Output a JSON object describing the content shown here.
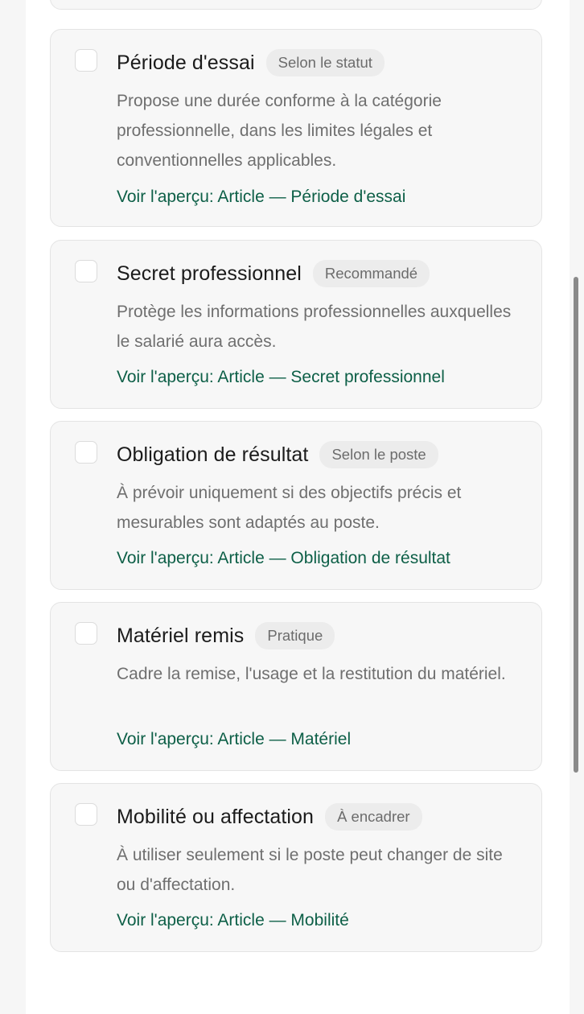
{
  "cards": [
    {
      "title": "Période d'essai",
      "badge": "Selon le statut",
      "description": "Propose une durée conforme à la catégorie professionnelle, dans les limites légales et conventionnelles applicables.",
      "link": "Voir l'aperçu: Article — Période d'essai"
    },
    {
      "title": "Secret professionnel",
      "badge": "Recommandé",
      "description": "Protège les informations professionnelles auxquelles le salarié aura accès.",
      "link": "Voir l'aperçu: Article — Secret professionnel"
    },
    {
      "title": "Obligation de résultat",
      "badge": "Selon le poste",
      "description": "À prévoir uniquement si des objectifs précis et mesurables sont adaptés au poste.",
      "link": "Voir l'aperçu: Article — Obligation de résultat"
    },
    {
      "title": "Matériel remis",
      "badge": "Pratique",
      "description": "Cadre la remise, l'usage et la restitution du matériel.",
      "link": "Voir l'aperçu: Article — Matériel"
    },
    {
      "title": "Mobilité ou affectation",
      "badge": "À encadrer",
      "description": "À utiliser seulement si le poste peut changer de site ou d'affectation.",
      "link": "Voir l'aperçu: Article — Mobilité"
    }
  ]
}
